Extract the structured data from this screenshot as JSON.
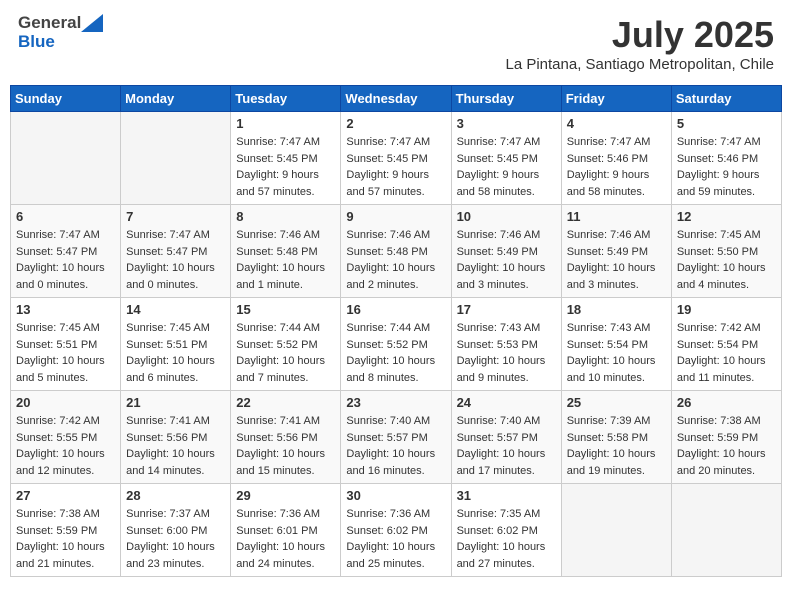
{
  "header": {
    "logo": {
      "general": "General",
      "blue": "Blue"
    },
    "title": "July 2025",
    "location": "La Pintana, Santiago Metropolitan, Chile"
  },
  "calendar": {
    "weekdays": [
      "Sunday",
      "Monday",
      "Tuesday",
      "Wednesday",
      "Thursday",
      "Friday",
      "Saturday"
    ],
    "weeks": [
      [
        {
          "day": "",
          "info": ""
        },
        {
          "day": "",
          "info": ""
        },
        {
          "day": "1",
          "info": "Sunrise: 7:47 AM\nSunset: 5:45 PM\nDaylight: 9 hours\nand 57 minutes."
        },
        {
          "day": "2",
          "info": "Sunrise: 7:47 AM\nSunset: 5:45 PM\nDaylight: 9 hours\nand 57 minutes."
        },
        {
          "day": "3",
          "info": "Sunrise: 7:47 AM\nSunset: 5:45 PM\nDaylight: 9 hours\nand 58 minutes."
        },
        {
          "day": "4",
          "info": "Sunrise: 7:47 AM\nSunset: 5:46 PM\nDaylight: 9 hours\nand 58 minutes."
        },
        {
          "day": "5",
          "info": "Sunrise: 7:47 AM\nSunset: 5:46 PM\nDaylight: 9 hours\nand 59 minutes."
        }
      ],
      [
        {
          "day": "6",
          "info": "Sunrise: 7:47 AM\nSunset: 5:47 PM\nDaylight: 10 hours\nand 0 minutes."
        },
        {
          "day": "7",
          "info": "Sunrise: 7:47 AM\nSunset: 5:47 PM\nDaylight: 10 hours\nand 0 minutes."
        },
        {
          "day": "8",
          "info": "Sunrise: 7:46 AM\nSunset: 5:48 PM\nDaylight: 10 hours\nand 1 minute."
        },
        {
          "day": "9",
          "info": "Sunrise: 7:46 AM\nSunset: 5:48 PM\nDaylight: 10 hours\nand 2 minutes."
        },
        {
          "day": "10",
          "info": "Sunrise: 7:46 AM\nSunset: 5:49 PM\nDaylight: 10 hours\nand 3 minutes."
        },
        {
          "day": "11",
          "info": "Sunrise: 7:46 AM\nSunset: 5:49 PM\nDaylight: 10 hours\nand 3 minutes."
        },
        {
          "day": "12",
          "info": "Sunrise: 7:45 AM\nSunset: 5:50 PM\nDaylight: 10 hours\nand 4 minutes."
        }
      ],
      [
        {
          "day": "13",
          "info": "Sunrise: 7:45 AM\nSunset: 5:51 PM\nDaylight: 10 hours\nand 5 minutes."
        },
        {
          "day": "14",
          "info": "Sunrise: 7:45 AM\nSunset: 5:51 PM\nDaylight: 10 hours\nand 6 minutes."
        },
        {
          "day": "15",
          "info": "Sunrise: 7:44 AM\nSunset: 5:52 PM\nDaylight: 10 hours\nand 7 minutes."
        },
        {
          "day": "16",
          "info": "Sunrise: 7:44 AM\nSunset: 5:52 PM\nDaylight: 10 hours\nand 8 minutes."
        },
        {
          "day": "17",
          "info": "Sunrise: 7:43 AM\nSunset: 5:53 PM\nDaylight: 10 hours\nand 9 minutes."
        },
        {
          "day": "18",
          "info": "Sunrise: 7:43 AM\nSunset: 5:54 PM\nDaylight: 10 hours\nand 10 minutes."
        },
        {
          "day": "19",
          "info": "Sunrise: 7:42 AM\nSunset: 5:54 PM\nDaylight: 10 hours\nand 11 minutes."
        }
      ],
      [
        {
          "day": "20",
          "info": "Sunrise: 7:42 AM\nSunset: 5:55 PM\nDaylight: 10 hours\nand 12 minutes."
        },
        {
          "day": "21",
          "info": "Sunrise: 7:41 AM\nSunset: 5:56 PM\nDaylight: 10 hours\nand 14 minutes."
        },
        {
          "day": "22",
          "info": "Sunrise: 7:41 AM\nSunset: 5:56 PM\nDaylight: 10 hours\nand 15 minutes."
        },
        {
          "day": "23",
          "info": "Sunrise: 7:40 AM\nSunset: 5:57 PM\nDaylight: 10 hours\nand 16 minutes."
        },
        {
          "day": "24",
          "info": "Sunrise: 7:40 AM\nSunset: 5:57 PM\nDaylight: 10 hours\nand 17 minutes."
        },
        {
          "day": "25",
          "info": "Sunrise: 7:39 AM\nSunset: 5:58 PM\nDaylight: 10 hours\nand 19 minutes."
        },
        {
          "day": "26",
          "info": "Sunrise: 7:38 AM\nSunset: 5:59 PM\nDaylight: 10 hours\nand 20 minutes."
        }
      ],
      [
        {
          "day": "27",
          "info": "Sunrise: 7:38 AM\nSunset: 5:59 PM\nDaylight: 10 hours\nand 21 minutes."
        },
        {
          "day": "28",
          "info": "Sunrise: 7:37 AM\nSunset: 6:00 PM\nDaylight: 10 hours\nand 23 minutes."
        },
        {
          "day": "29",
          "info": "Sunrise: 7:36 AM\nSunset: 6:01 PM\nDaylight: 10 hours\nand 24 minutes."
        },
        {
          "day": "30",
          "info": "Sunrise: 7:36 AM\nSunset: 6:02 PM\nDaylight: 10 hours\nand 25 minutes."
        },
        {
          "day": "31",
          "info": "Sunrise: 7:35 AM\nSunset: 6:02 PM\nDaylight: 10 hours\nand 27 minutes."
        },
        {
          "day": "",
          "info": ""
        },
        {
          "day": "",
          "info": ""
        }
      ]
    ]
  }
}
